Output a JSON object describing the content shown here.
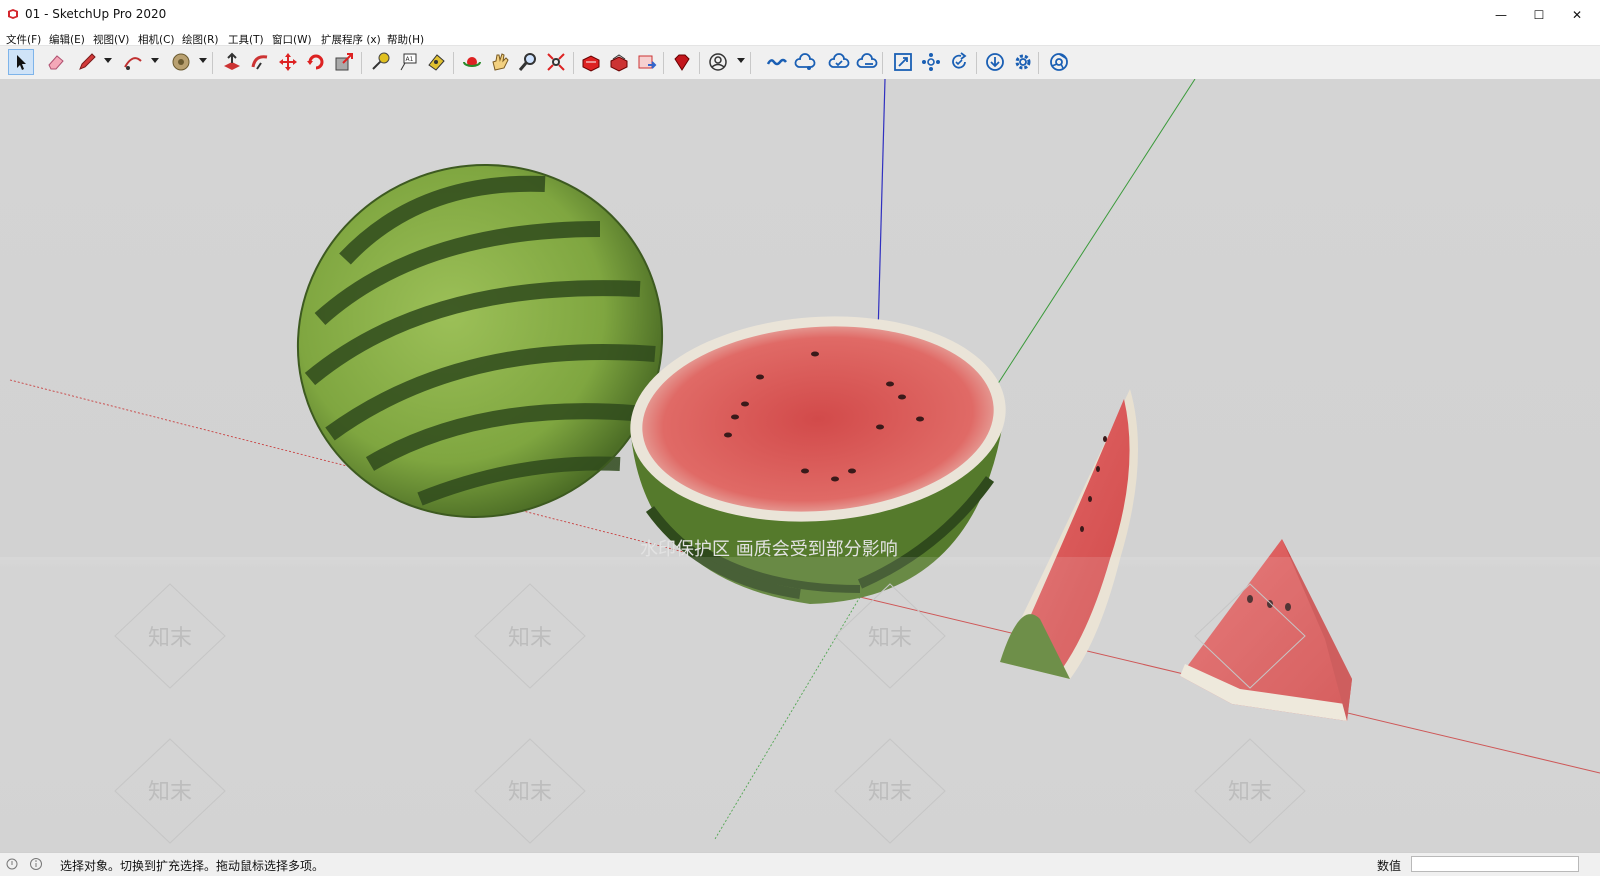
{
  "window": {
    "title": "01 - SketchUp Pro 2020",
    "controls": {
      "minimize": "—",
      "maximize": "☐",
      "close": "✕"
    }
  },
  "menu": [
    "文件(F)",
    "编辑(E)",
    "视图(V)",
    "相机(C)",
    "绘图(R)",
    "工具(T)",
    "窗口(W)",
    "扩展程序 (x)",
    "帮助(H)"
  ],
  "toolbar": {
    "tools": [
      "select-icon",
      "eraser-icon",
      "pencil-icon",
      "arc-icon",
      "paint-bucket-icon",
      "push-pull-icon",
      "follow-me-icon",
      "move-icon",
      "rotate-icon",
      "scale-icon",
      "tape-measure-icon",
      "text-icon",
      "paint-icon",
      "orbit-icon",
      "pan-icon",
      "zoom-icon",
      "zoom-extents-icon",
      "warehouse-icon",
      "extension-warehouse-icon",
      "layout-send-icon",
      "ruby-console-icon",
      "account-icon",
      "trimble-connect-icon",
      "cloud-share-icon",
      "cloud-check-icon",
      "cloud-upload-icon",
      "frame-icon",
      "components-icon",
      "refresh-icon",
      "download-icon",
      "settings-icon",
      "chrome-icon"
    ]
  },
  "viewport": {
    "watermark_text": "水印保护区  画质会受到部分影响",
    "watermark_brand": "知末"
  },
  "status": {
    "message": "选择对象。切换到扩充选择。拖动鼠标选择多项。",
    "value_label": "数值",
    "value_input": ""
  },
  "colors": {
    "toolbar_bg": "#f0f0f0",
    "axis_red": "#c84040",
    "axis_green": "#3a9a3a",
    "axis_blue": "#3030c0"
  }
}
